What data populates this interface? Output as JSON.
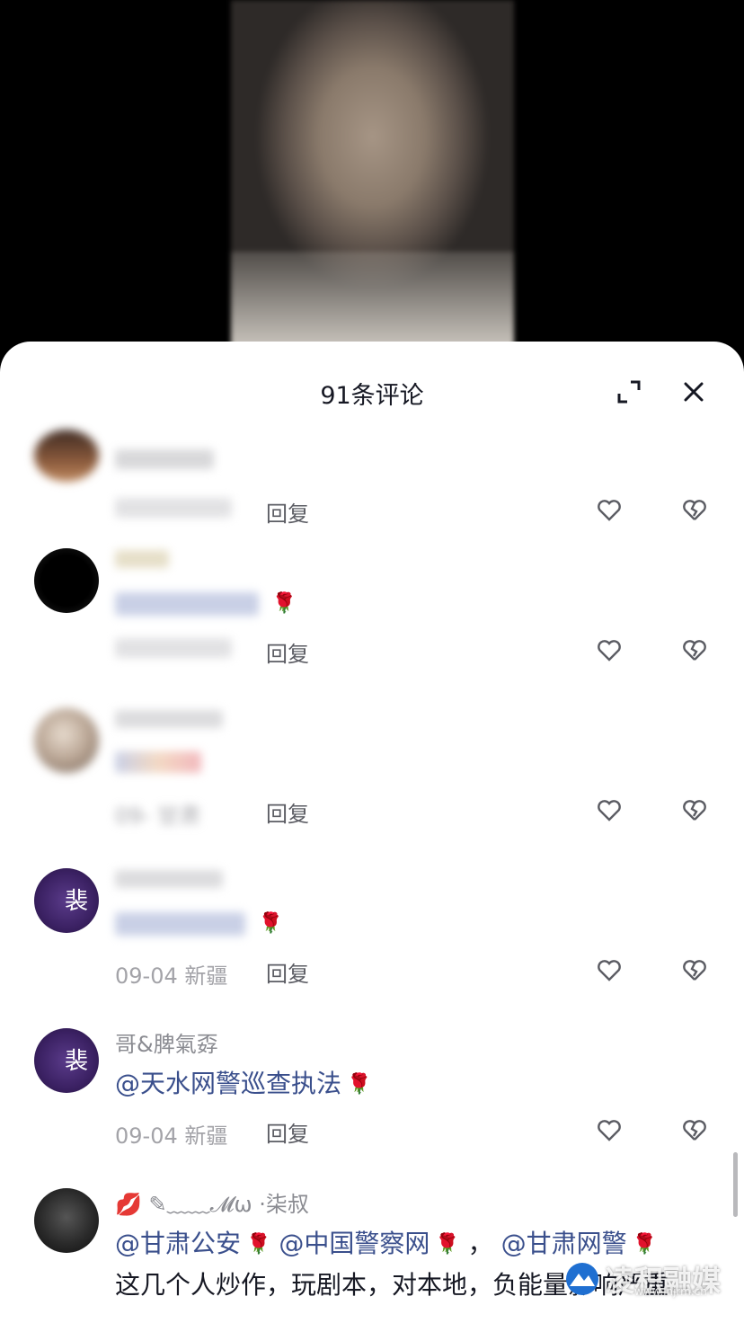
{
  "header": {
    "title": "91条评论",
    "expand_icon": "expand-icon",
    "close_icon": "close-icon"
  },
  "reply_label": "回复",
  "comments": [
    {
      "username": "",
      "text": "",
      "date": "",
      "location": "",
      "blurred": true
    },
    {
      "username": "",
      "text": "",
      "date": "",
      "location": "",
      "blurred": true
    },
    {
      "username": "",
      "text": "",
      "date": "09-",
      "location": "甘肃",
      "blurred": true
    },
    {
      "username": "",
      "text": "",
      "date": "09-04",
      "location": "新疆",
      "blurred": true
    },
    {
      "username": "哥&脾氣孬",
      "mention": "@天水网警巡查执法",
      "date": "09-04",
      "location": "新疆"
    },
    {
      "username_prefix": "✎﹏﹏𝓜ω",
      "username_suffix": "·柒叔",
      "mentions": [
        "@甘肃公安",
        "@中国警察网",
        "@甘肃网警"
      ],
      "separator": "，",
      "body": "这几个人炒作，玩剧本，对本地，负能量影响严重"
    }
  ],
  "watermark": {
    "text": "凌积融媒",
    "sub": "www.lnjrm.cn"
  },
  "colors": {
    "mention": "#3a4f8c",
    "meta": "#a3a3a8",
    "sheet": "#ffffff"
  }
}
